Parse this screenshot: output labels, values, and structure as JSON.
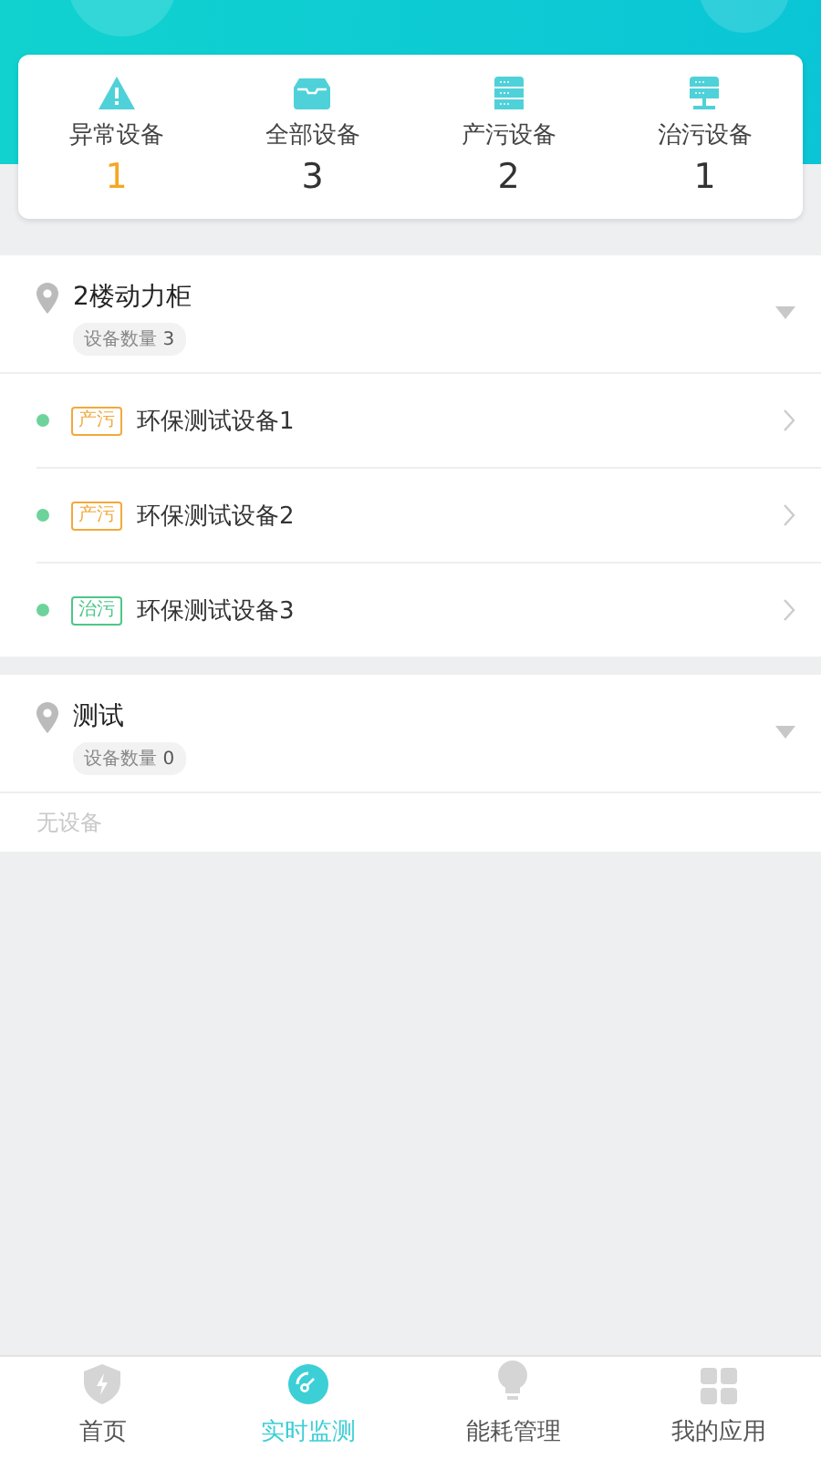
{
  "stats": [
    {
      "kind": "abnormal",
      "label": "异常设备",
      "count": "1"
    },
    {
      "kind": "all",
      "label": "全部设备",
      "count": "3"
    },
    {
      "kind": "produce",
      "label": "产污设备",
      "count": "2"
    },
    {
      "kind": "treat",
      "label": "治污设备",
      "count": "1"
    }
  ],
  "groups": [
    {
      "name": "2楼动力柜",
      "count_label": "设备数量",
      "count": "3",
      "devices": [
        {
          "color": "#6dd39b",
          "tag": {
            "kind": "produce",
            "label": "产污"
          },
          "name": "环保测试设备1"
        },
        {
          "color": "#6dd39b",
          "tag": {
            "kind": "produce",
            "label": "产污"
          },
          "name": "环保测试设备2"
        },
        {
          "color": "#6dd39b",
          "tag": {
            "kind": "treat",
            "label": "治污"
          },
          "name": "环保测试设备3"
        }
      ]
    },
    {
      "name": "测试",
      "count_label": "设备数量",
      "count": "0",
      "empty_text": "无设备"
    }
  ],
  "nav": [
    {
      "kind": "home",
      "label": "首页",
      "selected": false
    },
    {
      "kind": "monitor",
      "label": "实时监测",
      "selected": true
    },
    {
      "kind": "energy",
      "label": "能耗管理",
      "selected": false
    },
    {
      "kind": "apps",
      "label": "我的应用",
      "selected": false
    }
  ]
}
